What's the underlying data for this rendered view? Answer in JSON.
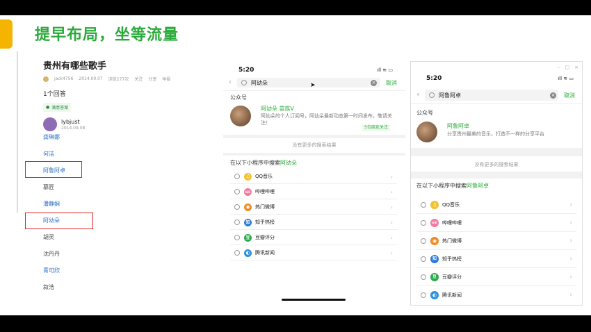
{
  "slide": {
    "title": "提早布局，坐等流量"
  },
  "zhihu": {
    "question": "贵州有哪些歌手",
    "meta": [
      "jack4756",
      "2014.09.07",
      "浏览277次",
      "关注",
      "分享",
      "举报"
    ],
    "answer_count": "1个回答",
    "badge": "满意答案",
    "user_name": "lybjust",
    "user_date": "2014.09.08",
    "list": [
      {
        "text": "龚琳娜",
        "color": "#2a6fc7"
      },
      {
        "text": "何洁",
        "color": "#2a6fc7"
      },
      {
        "text": "阿鲁阿卓",
        "color": "#2a6fc7"
      },
      {
        "text": "慕匠",
        "color": "#444444"
      },
      {
        "text": "潘静娴",
        "color": "#2a6fc7"
      },
      {
        "text": "阿幼朵",
        "color": "#2a6fc7"
      },
      {
        "text": "胡灵",
        "color": "#444444"
      },
      {
        "text": "沈丹丹",
        "color": "#444444"
      },
      {
        "text": "青可欣",
        "color": "#2a6fc7"
      },
      {
        "text": "叙浩",
        "color": "#444444"
      }
    ]
  },
  "phone1": {
    "time": "5:20",
    "signal": "ıll ≋ ▭",
    "query": "阿幼朵",
    "cancel": "取消",
    "section": "公众号",
    "account_name": "阿幼朵 苗族V",
    "account_desc": "阿幼朵的个人订阅号，阿幼朵最新动态第一时间发布，敬请关注！",
    "tag": "5位朋友关注",
    "no_more": "没有更多的搜索结果",
    "mp_prefix": "在以下小程序中搜索",
    "mp_keyword": "阿幼朵",
    "programs": [
      {
        "label": "QQ音乐",
        "icon": "♫",
        "color": "#f2c330"
      },
      {
        "label": "哔哩哔哩",
        "icon": "bili",
        "color": "#f07aa0"
      },
      {
        "label": "热门微博",
        "icon": "◉",
        "color": "#f08a20"
      },
      {
        "label": "知乎热榜",
        "icon": "知",
        "color": "#2a7be0"
      },
      {
        "label": "豆瓣评分",
        "icon": "豆",
        "color": "#2aa84a"
      },
      {
        "label": "腾讯新闻",
        "icon": "◐",
        "color": "#2a90e0"
      }
    ]
  },
  "phone2": {
    "time": "5:20",
    "signal": "ıll ≋ ▭",
    "query": "阿鲁阿卓",
    "cancel": "取消",
    "section": "公众号",
    "account_name": "阿鲁阿卓",
    "account_desc": "分享贵州最美的音乐，打造不一样的分享平台",
    "no_more": "没有更多的搜索结果",
    "mp_prefix": "在以下小程序中搜索",
    "mp_keyword": "阿鲁阿卓",
    "window_buttons": [
      "–",
      "□",
      "×"
    ],
    "programs": [
      {
        "label": "QQ音乐",
        "icon": "♫",
        "color": "#f2c330"
      },
      {
        "label": "哔哩哔哩",
        "icon": "bili",
        "color": "#f07aa0"
      },
      {
        "label": "热门微博",
        "icon": "◉",
        "color": "#f08a20"
      },
      {
        "label": "知乎热榜",
        "icon": "知",
        "color": "#2a7be0"
      },
      {
        "label": "豆瓣评分",
        "icon": "豆",
        "color": "#2aa84a"
      },
      {
        "label": "腾讯新闻",
        "icon": "◐",
        "color": "#2a90e0"
      }
    ]
  },
  "toolbar": {
    "icons": "✎ ▤ ⬡ ⌀ ◫ ▭"
  }
}
